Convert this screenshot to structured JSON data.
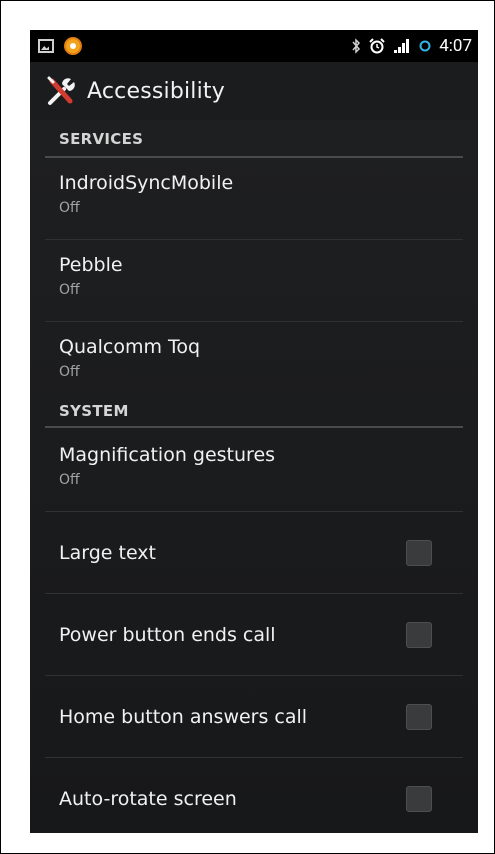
{
  "status_bar": {
    "time": "4:07",
    "icons": [
      "image-icon",
      "app-notification-icon",
      "bluetooth-icon",
      "alarm-icon",
      "signal-icon",
      "sync-icon"
    ]
  },
  "action_bar": {
    "title": "Accessibility",
    "icon": "wrench-screwdriver-icon"
  },
  "sections": {
    "services": {
      "header": "SERVICES",
      "items": [
        {
          "title": "IndroidSyncMobile",
          "summary": "Off"
        },
        {
          "title": "Pebble",
          "summary": "Off"
        },
        {
          "title": "Qualcomm Toq",
          "summary": "Off"
        }
      ]
    },
    "system": {
      "header": "SYSTEM",
      "items": [
        {
          "title": "Magnification gestures",
          "summary": "Off"
        },
        {
          "title": "Large text",
          "checked": false
        },
        {
          "title": "Power button ends call",
          "checked": false
        },
        {
          "title": "Home button answers call",
          "checked": false
        },
        {
          "title": "Auto-rotate screen",
          "checked": false
        }
      ]
    }
  },
  "colors": {
    "background": "#1c1d1f",
    "status_bar": "#000000",
    "text_primary": "#f1f1f1",
    "text_secondary": "#a3a3a3",
    "divider": "#4a4b4c"
  }
}
